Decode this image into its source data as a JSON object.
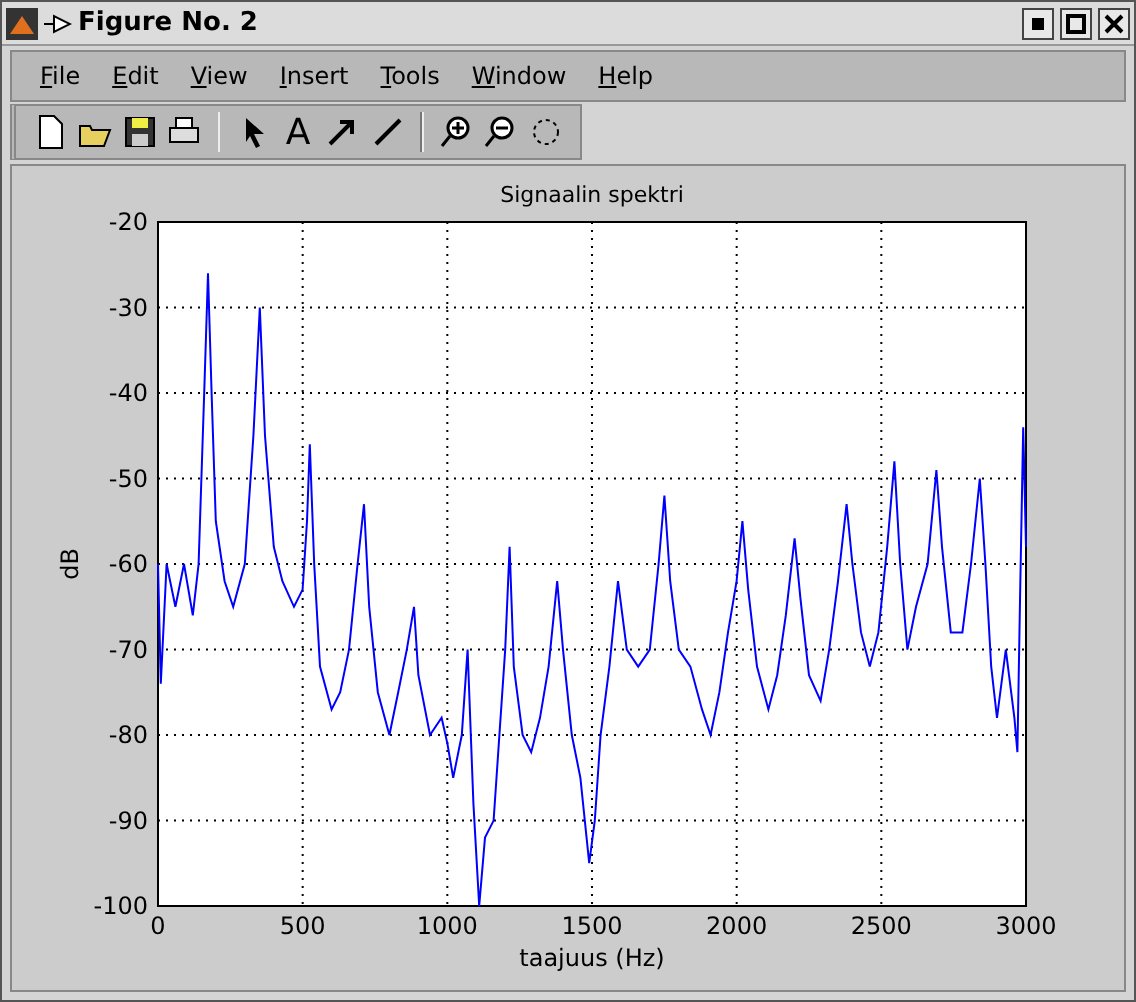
{
  "window": {
    "title": "Figure No. 2"
  },
  "menu": [
    {
      "label": "File"
    },
    {
      "label": "Edit"
    },
    {
      "label": "View"
    },
    {
      "label": "Insert"
    },
    {
      "label": "Tools"
    },
    {
      "label": "Window"
    },
    {
      "label": "Help"
    }
  ],
  "toolbar": [
    {
      "kind": "new"
    },
    {
      "kind": "open"
    },
    {
      "kind": "save"
    },
    {
      "kind": "print"
    },
    {
      "kind": "separator"
    },
    {
      "kind": "select"
    },
    {
      "kind": "text",
      "label": "A"
    },
    {
      "kind": "arrow"
    },
    {
      "kind": "line"
    },
    {
      "kind": "separator"
    },
    {
      "kind": "zoom-in"
    },
    {
      "kind": "zoom-out"
    },
    {
      "kind": "rotate"
    }
  ],
  "figure": {
    "chart_data": {
      "type": "line",
      "title": "Signaalin spektri",
      "xlabel": "taajuus (Hz)",
      "ylabel": "dB",
      "xlim": [
        0,
        3000
      ],
      "ylim": [
        -100,
        -20
      ],
      "xticks": [
        0,
        500,
        1000,
        1500,
        2000,
        2500,
        3000
      ],
      "yticks": [
        -100,
        -90,
        -80,
        -70,
        -60,
        -50,
        -40,
        -30,
        -20
      ],
      "x": [
        0,
        10,
        30,
        60,
        90,
        120,
        140,
        160,
        173,
        185,
        200,
        230,
        260,
        300,
        330,
        352,
        370,
        400,
        430,
        470,
        500,
        515,
        525,
        540,
        560,
        600,
        630,
        660,
        690,
        712,
        730,
        760,
        800,
        830,
        860,
        885,
        900,
        940,
        980,
        1000,
        1020,
        1050,
        1070,
        1090,
        1110,
        1130,
        1160,
        1180,
        1200,
        1215,
        1230,
        1260,
        1290,
        1320,
        1350,
        1380,
        1400,
        1430,
        1460,
        1490,
        1510,
        1530,
        1560,
        1590,
        1620,
        1660,
        1700,
        1730,
        1750,
        1770,
        1800,
        1840,
        1880,
        1910,
        1940,
        1970,
        2000,
        2020,
        2040,
        2070,
        2110,
        2140,
        2170,
        2200,
        2220,
        2250,
        2290,
        2320,
        2350,
        2380,
        2400,
        2430,
        2460,
        2490,
        2520,
        2545,
        2565,
        2590,
        2620,
        2660,
        2690,
        2710,
        2740,
        2780,
        2810,
        2840,
        2860,
        2880,
        2900,
        2930,
        2960,
        2970,
        2980,
        2990,
        3000
      ],
      "grid": true,
      "series": [
        {
          "color": "#0000ff",
          "values": [
            -60,
            -74,
            -60,
            -65,
            -60,
            -66,
            -60,
            -40,
            -26,
            -40,
            -55,
            -62,
            -65,
            -60,
            -45,
            -30,
            -45,
            -58,
            -62,
            -65,
            -63,
            -55,
            -46,
            -60,
            -72,
            -77,
            -75,
            -70,
            -60,
            -53,
            -65,
            -75,
            -80,
            -75,
            -70,
            -65,
            -73,
            -80,
            -78,
            -81,
            -85,
            -80,
            -70,
            -88,
            -100,
            -92,
            -90,
            -80,
            -70,
            -58,
            -72,
            -80,
            -82,
            -78,
            -72,
            -62,
            -70,
            -80,
            -85,
            -95,
            -90,
            -80,
            -72,
            -62,
            -70,
            -72,
            -70,
            -60,
            -52,
            -62,
            -70,
            -72,
            -77,
            -80,
            -75,
            -68,
            -62,
            -55,
            -63,
            -72,
            -77,
            -73,
            -66,
            -57,
            -64,
            -73,
            -76,
            -70,
            -62,
            -53,
            -60,
            -68,
            -72,
            -68,
            -58,
            -48,
            -60,
            -70,
            -65,
            -60,
            -49,
            -58,
            -68,
            -68,
            -60,
            -50,
            -60,
            -72,
            -78,
            -70,
            -78,
            -82,
            -63,
            -44,
            -58
          ]
        }
      ]
    }
  }
}
